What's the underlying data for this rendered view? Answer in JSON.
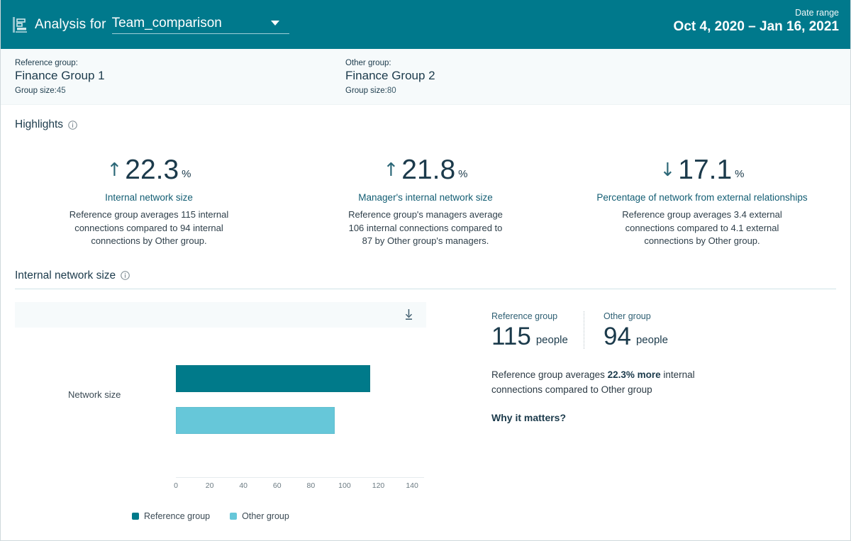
{
  "header": {
    "icon": "report-icon",
    "analysis_label": "Analysis for",
    "report_name": "Team_comparison",
    "dropdown_icon": "chevron-down-icon",
    "date_range_label": "Date range",
    "date_range_value": "Oct 4, 2020 – Jan 16, 2021",
    "background_color": "#00798c"
  },
  "groups": {
    "reference": {
      "kicker": "Reference group:",
      "name": "Finance Group 1",
      "size_label": "Group size:",
      "size_value": "45"
    },
    "other": {
      "kicker": "Other group:",
      "name": "Finance Group 2",
      "size_label": "Group size:",
      "size_value": "80"
    }
  },
  "highlights": {
    "title": "Highlights",
    "info_icon": "info-circle-icon",
    "cards": [
      {
        "arrow": "↑",
        "direction": "up",
        "value": "22.3",
        "unit": "%",
        "metric": "Internal network size",
        "description": "Reference group averages 115 internal connections compared to 94 internal connections by Other group."
      },
      {
        "arrow": "↑",
        "direction": "up",
        "value": "21.8",
        "unit": "%",
        "metric": "Manager's internal network size",
        "description": "Reference group's managers average 106 internal connections compared to 87 by Other group's managers."
      },
      {
        "arrow": "↓",
        "direction": "down",
        "value": "17.1",
        "unit": "%",
        "metric": "Percentage of network from external relationships",
        "description": "Reference group averages 3.4 external connections compared to 4.1 external connections by Other group."
      }
    ]
  },
  "internal_network_size": {
    "title": "Internal network size",
    "info_icon": "info-circle-icon",
    "download_icon": "download-icon",
    "stats": {
      "reference": {
        "kicker": "Reference group",
        "value": "115",
        "unit": "people"
      },
      "other": {
        "kicker": "Other group",
        "value": "94",
        "unit": "people"
      }
    },
    "summary_prefix": "Reference group averages ",
    "summary_highlight": "22.3% more",
    "summary_suffix": " internal connections compared to Other group",
    "why_link": "Why it matters?"
  },
  "chart_data": {
    "type": "bar",
    "orientation": "horizontal",
    "title": "Internal network size",
    "xlabel": "",
    "ylabel": "",
    "categories": [
      "Network size"
    ],
    "series": [
      {
        "name": "Reference group",
        "values": [
          115
        ],
        "color": "#007a8a"
      },
      {
        "name": "Other group",
        "values": [
          94
        ],
        "color": "#66c7d9"
      }
    ],
    "xlim": [
      0,
      145
    ],
    "xticks": [
      0,
      20,
      40,
      60,
      80,
      100,
      120,
      140
    ],
    "xtick_labels": [
      "0",
      "20",
      "40",
      "60",
      "80",
      "100",
      "120",
      "140"
    ],
    "grid": false,
    "legend_position": "bottom",
    "legend": [
      "Reference group",
      "Other group"
    ]
  },
  "colors": {
    "brand_teal": "#00798c",
    "reference_bar": "#007a8a",
    "other_bar": "#66c7d9",
    "text_dark": "#1b3a4b",
    "accent_link": "#125d73",
    "panel_bg": "#f6fafb"
  }
}
